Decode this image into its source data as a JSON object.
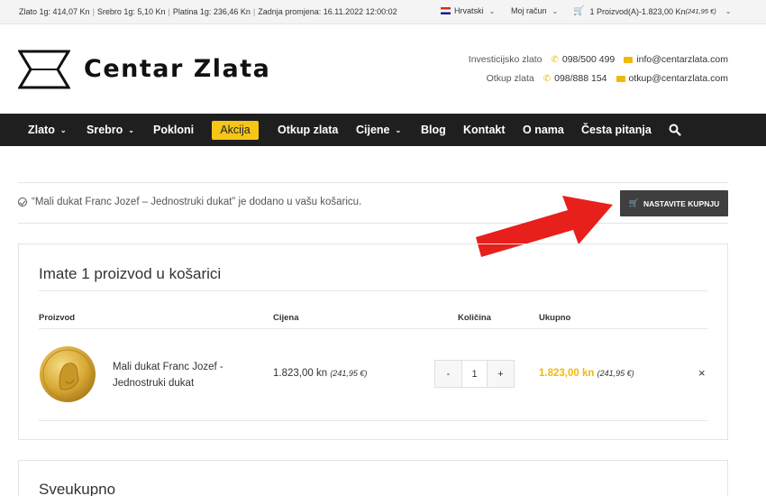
{
  "topbar": {
    "gold_price": "Zlato 1g: 414,07 Kn",
    "silver_price": "Srebro 1g: 5,10 Kn",
    "platinum_price": "Platina 1g: 236,46 Kn",
    "last_change": "Zadnja promjena: 16.11.2022 12:00:02",
    "language": "Hrvatski",
    "account": "Moj račun",
    "cart_summary": "1 Proizvod(A)-1.823,00 Kn",
    "cart_summary_eur": "(241,95 €)"
  },
  "header": {
    "logo_text": "Centar Zlata",
    "contact_rows": [
      {
        "label": "Investicijsko zlato",
        "phone": "098/500 499",
        "email": "info@centarzlata.com"
      },
      {
        "label": "Otkup zlata",
        "phone": "098/888 154",
        "email": "otkup@centarzlata.com"
      }
    ]
  },
  "nav": {
    "items": [
      "Zlato",
      "Srebro",
      "Pokloni",
      "Akcija",
      "Otkup zlata",
      "Cijene",
      "Blog",
      "Kontakt",
      "O nama",
      "Česta pitanja"
    ]
  },
  "notice": {
    "message": "“Mali dukat Franc Jozef – Jednostruki dukat” je dodano u vašu košaricu.",
    "continue_label": "NASTAVITE KUPNJU"
  },
  "cart": {
    "title": "Imate 1 proizvod u košarici",
    "columns": [
      "Proizvod",
      "Cijena",
      "Količina",
      "Ukupno"
    ],
    "rows": [
      {
        "name": "Mali dukat Franc Jozef - Jednostruki dukat",
        "price": "1.823,00 kn",
        "price_eur": "(241,95 €)",
        "quantity": "1",
        "total": "1.823,00 kn",
        "total_eur": "(241,95 €)"
      }
    ],
    "qty_minus": "-",
    "qty_plus": "+",
    "remove_symbol": "×"
  },
  "totals": {
    "title": "Sveukupno"
  },
  "colors": {
    "accent_gold": "#f0b90b",
    "akcija_badge": "#f5c518",
    "nav_bg": "#1f1f1f",
    "arrow": "#e8201c"
  }
}
